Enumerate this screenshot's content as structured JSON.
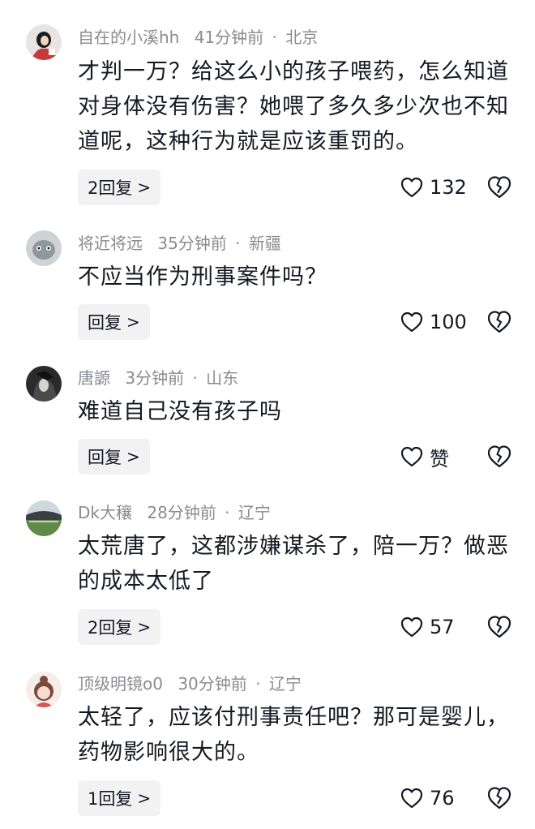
{
  "comments": [
    {
      "username": "自在的小溪hh",
      "time": "41分钟前",
      "location": "北京",
      "text": "才判一万？给这么小的孩子喂药，怎么知道对身体没有伤害？她喂了多久多少次也不知道呢，这种行为就是应该重罚的。",
      "reply_label": "2回复",
      "likes": "132",
      "avatar_color": "#c73a3a"
    },
    {
      "username": "将近将远",
      "time": "35分钟前",
      "location": "新疆",
      "text": "不应当作为刑事案件吗？",
      "reply_label": "回复",
      "likes": "100",
      "avatar_color": "#9aa3a8"
    },
    {
      "username": "唐謜",
      "time": "3分钟前",
      "location": "山东",
      "text": "难道自己没有孩子吗",
      "reply_label": "回复",
      "likes": "赞",
      "avatar_color": "#2b2b2b"
    },
    {
      "username": "Dk大穰",
      "time": "28分钟前",
      "location": "辽宁",
      "text": "太荒唐了，这都涉嫌谋杀了，陪一万？做恶的成本太低了",
      "reply_label": "2回复",
      "likes": "57",
      "avatar_color": "#5f8a4a"
    },
    {
      "username": "顶级明镜o0",
      "time": "30分钟前",
      "location": "辽宁",
      "text": "太轻了，应该付刑事责任吧？那可是婴儿，药物影响很大的。",
      "reply_label": "1回复",
      "likes": "76",
      "avatar_color": "#f3d9d4"
    }
  ],
  "separator": "·",
  "chevron": ">"
}
